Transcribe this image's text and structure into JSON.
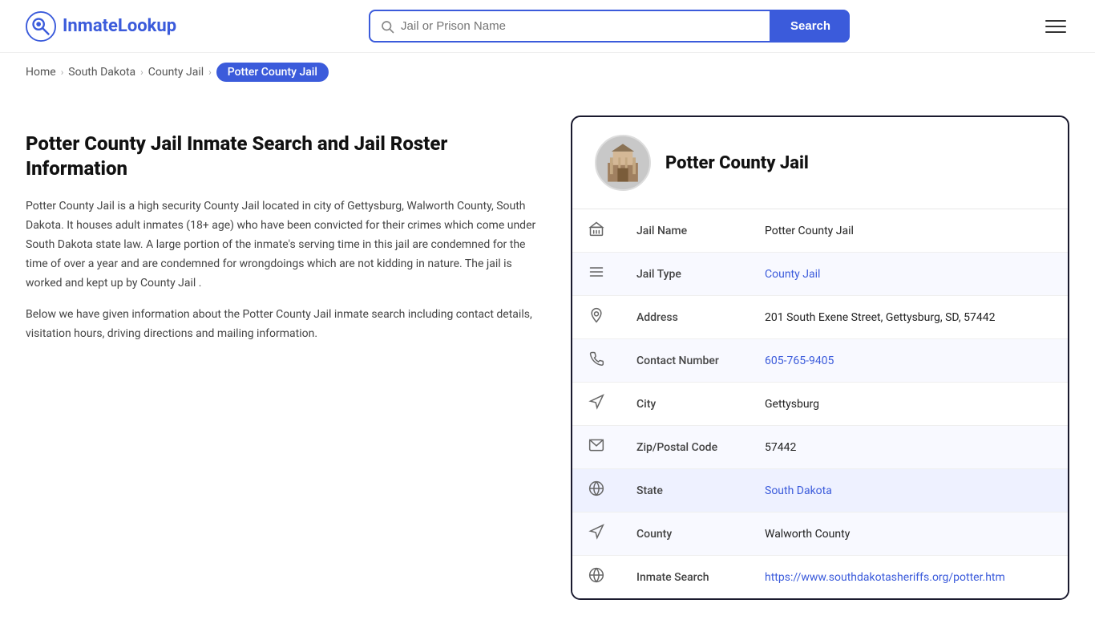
{
  "header": {
    "logo_text_start": "Inmate",
    "logo_text_end": "Lookup",
    "search_placeholder": "Jail or Prison Name",
    "search_button_label": "Search"
  },
  "breadcrumb": {
    "home": "Home",
    "state": "South Dakota",
    "type": "County Jail",
    "current": "Potter County Jail"
  },
  "left": {
    "page_title": "Potter County Jail Inmate Search and Jail Roster Information",
    "desc1": "Potter County Jail is a high security County Jail located in city of Gettysburg, Walworth County, South Dakota. It houses adult inmates (18+ age) who have been convicted for their crimes which come under South Dakota state law. A large portion of the inmate's serving time in this jail are condemned for the time of over a year and are condemned for wrongdoings which are not kidding in nature. The jail is worked and kept up by County Jail .",
    "desc2": "Below we have given information about the Potter County Jail inmate search including contact details, visitation hours, driving directions and mailing information."
  },
  "card": {
    "title": "Potter County Jail",
    "rows": [
      {
        "icon": "jail-icon",
        "label": "Jail Name",
        "value": "Potter County Jail",
        "link": null
      },
      {
        "icon": "type-icon",
        "label": "Jail Type",
        "value": "County Jail",
        "link": "#"
      },
      {
        "icon": "address-icon",
        "label": "Address",
        "value": "201 South Exene Street, Gettysburg, SD, 57442",
        "link": null
      },
      {
        "icon": "phone-icon",
        "label": "Contact Number",
        "value": "605-765-9405",
        "link": "tel:605-765-9405"
      },
      {
        "icon": "city-icon",
        "label": "City",
        "value": "Gettysburg",
        "link": null
      },
      {
        "icon": "zip-icon",
        "label": "Zip/Postal Code",
        "value": "57442",
        "link": null
      },
      {
        "icon": "state-icon",
        "label": "State",
        "value": "South Dakota",
        "link": "#",
        "highlighted": true
      },
      {
        "icon": "county-icon",
        "label": "County",
        "value": "Walworth County",
        "link": null
      },
      {
        "icon": "inmate-icon",
        "label": "Inmate Search",
        "value": "https://www.southdakotasheriffs.org/potter.htm",
        "link": "https://www.southdakotasheriffs.org/potter.htm"
      }
    ]
  },
  "icons": {
    "jail-icon": "🏛",
    "type-icon": "☰",
    "address-icon": "📍",
    "phone-icon": "📞",
    "city-icon": "🗺",
    "zip-icon": "✉",
    "state-icon": "🌐",
    "county-icon": "🗺",
    "inmate-icon": "🌐"
  }
}
